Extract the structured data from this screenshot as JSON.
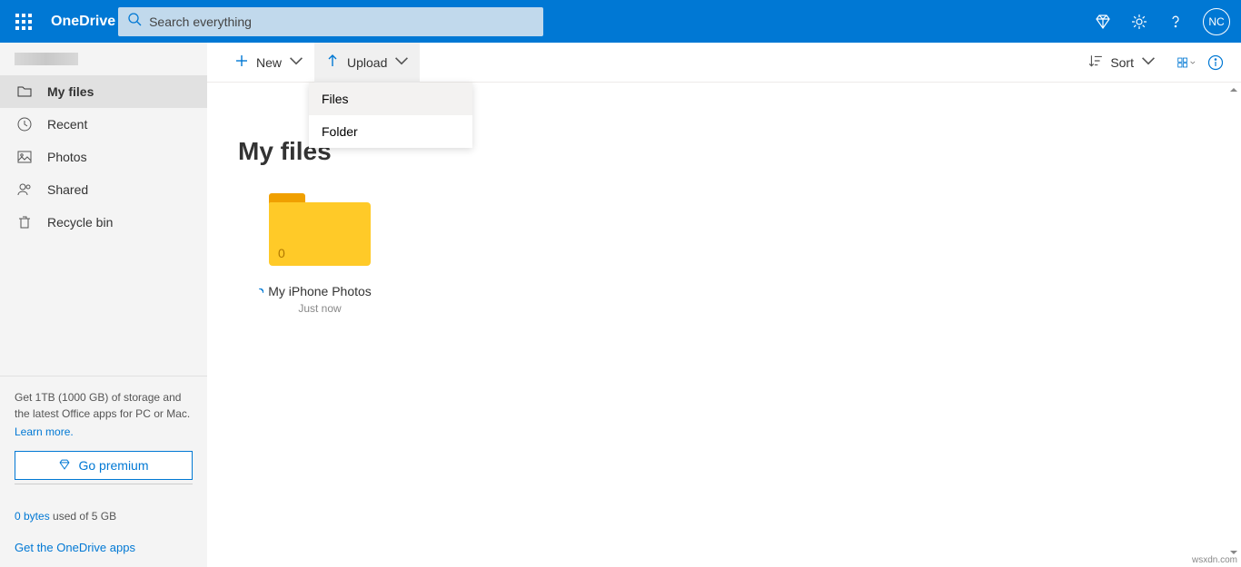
{
  "header": {
    "app_title": "OneDrive",
    "search_placeholder": "Search everything",
    "avatar_initials": "NC"
  },
  "sidebar": {
    "items": [
      {
        "label": "My files",
        "icon": "folder"
      },
      {
        "label": "Recent",
        "icon": "clock"
      },
      {
        "label": "Photos",
        "icon": "image"
      },
      {
        "label": "Shared",
        "icon": "person"
      },
      {
        "label": "Recycle bin",
        "icon": "trash"
      }
    ],
    "promo": "Get 1TB (1000 GB) of storage and the latest Office apps for PC or Mac.",
    "learn_more": "Learn more.",
    "premium_label": "Go premium",
    "storage_used": "0 bytes",
    "storage_total": " used of 5 GB",
    "get_apps": "Get the OneDrive apps"
  },
  "toolbar": {
    "new_label": "New",
    "upload_label": "Upload",
    "sort_label": "Sort"
  },
  "dropdown": {
    "files": "Files",
    "folder": "Folder"
  },
  "content": {
    "page_title": "My files",
    "folders": [
      {
        "name": "My iPhone Photos",
        "count": "0",
        "time": "Just now"
      }
    ]
  },
  "watermark": "wsxdn.com"
}
